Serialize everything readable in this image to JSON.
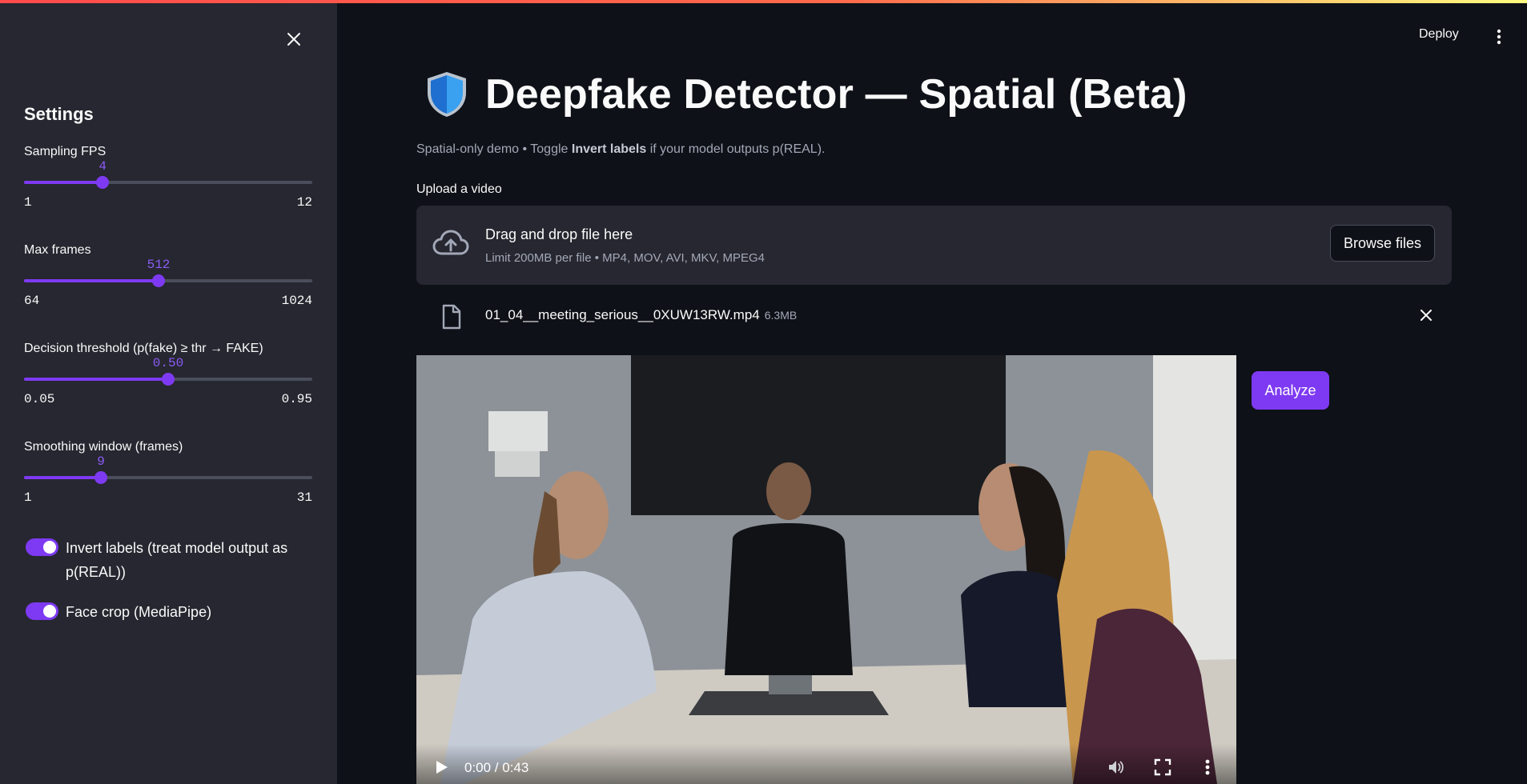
{
  "sidebar": {
    "title": "Settings",
    "sliders": [
      {
        "label": "Sampling FPS",
        "value": "4",
        "min": "1",
        "max": "12",
        "fraction": 0.2727
      },
      {
        "label": "Max frames",
        "value": "512",
        "min": "64",
        "max": "1024",
        "fraction": 0.4667
      },
      {
        "label": "Decision threshold (p(fake) ≥ thr → FAKE)",
        "value": "0.50",
        "min": "0.05",
        "max": "0.95",
        "fraction": 0.5
      },
      {
        "label": "Smoothing window (frames)",
        "value": "9",
        "min": "1",
        "max": "31",
        "fraction": 0.2667
      }
    ],
    "toggles": [
      {
        "label": "Invert labels (treat model output as p(REAL))",
        "on": true
      },
      {
        "label": "Face crop (MediaPipe)",
        "on": true
      }
    ]
  },
  "header": {
    "deploy_label": "Deploy"
  },
  "main": {
    "title": "Deepfake Detector — Spatial (Beta)",
    "caption_pre": "Spatial-only demo • Toggle ",
    "caption_bold": "Invert labels",
    "caption_post": " if your model outputs p(REAL).",
    "upload_label": "Upload a video",
    "dropzone": {
      "title": "Drag and drop file here",
      "limit": "Limit 200MB per file • MP4, MOV, AVI, MKV, MPEG4",
      "browse_label": "Browse files"
    },
    "file": {
      "name": "01_04__meeting_serious__0XUW13RW.mp4",
      "size": "6.3MB"
    },
    "video": {
      "time": "0:00 / 0:43"
    },
    "analyze_label": "Analyze"
  },
  "colors": {
    "accent": "#7e3af2",
    "background": "#0e1117",
    "sidebar": "#262730"
  }
}
